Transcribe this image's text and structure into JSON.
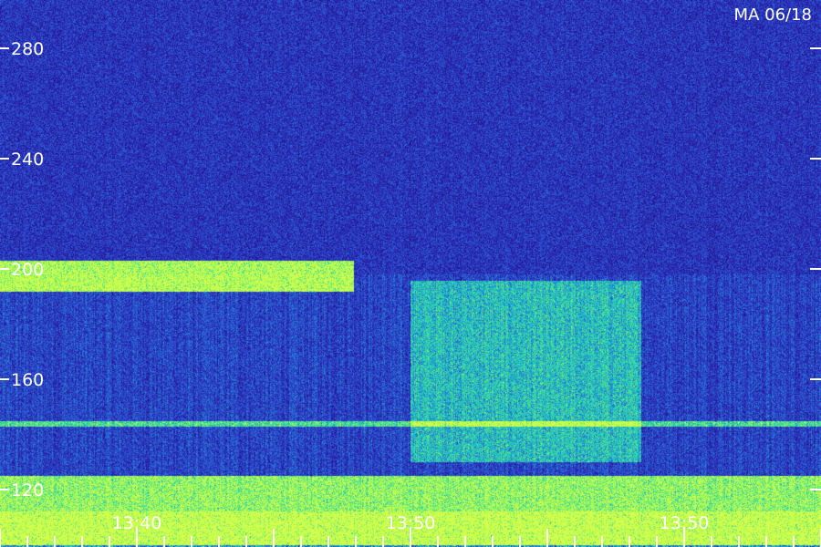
{
  "chart_data": {
    "type": "heatmap",
    "title": "MA 06/18",
    "y_unit": "m",
    "y_ticks": [
      120,
      160,
      200,
      240,
      280
    ],
    "ylim": [
      100,
      300
    ],
    "x_tick_labels": [
      "13:40",
      "13:50",
      "13:50"
    ],
    "bands": [
      {
        "name": "strong-echo",
        "y_from": 192,
        "y_to": 203,
        "x_from": 0,
        "x_to": 0.43,
        "intensity": 0.85
      },
      {
        "name": "faint-layer",
        "y_from": 130,
        "y_to": 196,
        "x_from": 0.5,
        "x_to": 0.78,
        "intensity": 0.35
      },
      {
        "name": "thin-line",
        "y_from": 143,
        "y_to": 145,
        "x_from": 0,
        "x_to": 1,
        "intensity": 0.5
      },
      {
        "name": "ground-clutter",
        "y_from": 100,
        "y_to": 125,
        "x_from": 0,
        "x_to": 1,
        "intensity": 0.7
      }
    ],
    "colormap": [
      "#140a3a",
      "#2a1aa8",
      "#2a5fd8",
      "#19c6c8",
      "#6ef06a",
      "#d6ff4a"
    ]
  }
}
